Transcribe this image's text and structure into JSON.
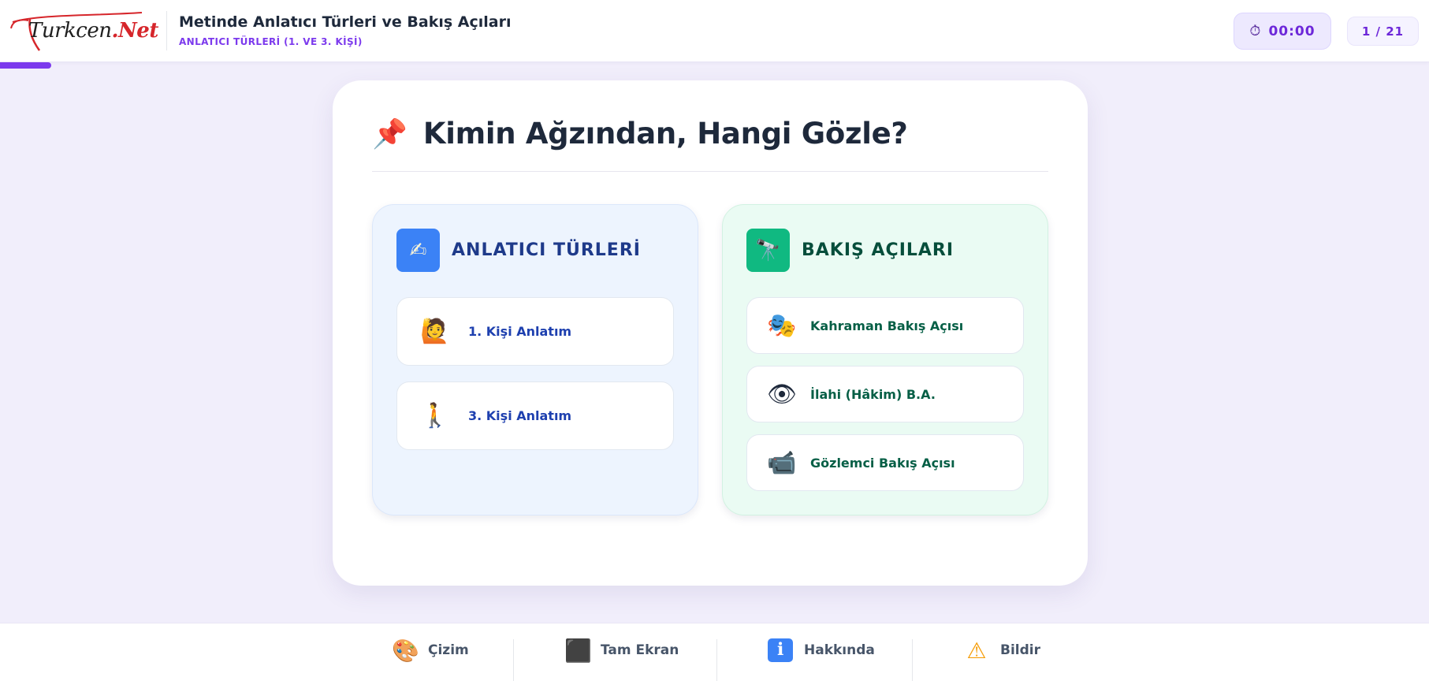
{
  "header": {
    "logo_part1": "Turkcen",
    "logo_part2": ".Net",
    "title": "Metinde Anlatıcı Türleri ve Bakış Açıları",
    "subtitle": "ANLATICI TÜRLERİ (1. VE 3. KİŞİ)",
    "timer_icon": "⏱",
    "timer": "00:00",
    "page_counter": "1 / 21",
    "progress_fraction": 0.036
  },
  "card": {
    "icon": "📌",
    "title": "Kimin Ağzından, Hangi Gözle?",
    "left_panel": {
      "icon": "✍",
      "title": "ANLATICI TÜRLERİ",
      "items": [
        {
          "icon": "🙋",
          "label": "1. Kişi Anlatım"
        },
        {
          "icon": "🚶",
          "label": "3. Kişi Anlatım"
        }
      ]
    },
    "right_panel": {
      "icon": "🔭",
      "title": "BAKIŞ AÇILARI",
      "items": [
        {
          "icon": "🎭",
          "label": "Kahraman Bakış Açısı"
        },
        {
          "icon": "👁",
          "label": "İlahi (Hâkim) B.A."
        },
        {
          "icon": "📹",
          "label": "Gözlemci Bakış Açısı"
        }
      ]
    }
  },
  "footer": {
    "items": [
      {
        "icon": "🎨",
        "label": "Çizim"
      },
      {
        "icon": "⬛",
        "label": "Tam Ekran"
      },
      {
        "icon": "ℹ",
        "label": "Hakkında"
      },
      {
        "icon": "⚠",
        "label": "Bildir"
      }
    ]
  },
  "colors": {
    "accent": "#7c3aed",
    "blue_panel": "#edf4fe",
    "green_panel": "#eafbf3",
    "background": "#f1eefb"
  }
}
